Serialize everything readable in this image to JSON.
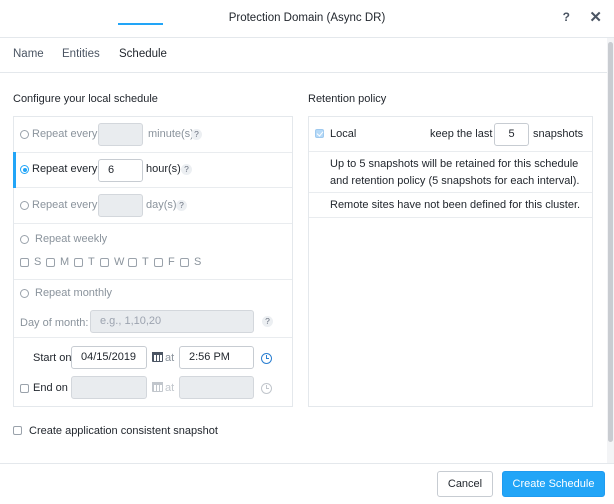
{
  "dialog": {
    "title": "Protection Domain (Async DR)",
    "help_label": "?",
    "close_label": "✕"
  },
  "tabs": [
    {
      "label": "Name",
      "active": false
    },
    {
      "label": "Entities",
      "active": false
    },
    {
      "label": "Schedule",
      "active": true
    }
  ],
  "local_schedule": {
    "title": "Configure your local schedule",
    "repeat_minutes": {
      "label": "Repeat every",
      "value": "",
      "unit": "minute(s)",
      "selected": false
    },
    "repeat_hours": {
      "label": "Repeat every",
      "value": "6",
      "unit": "hour(s)",
      "selected": true
    },
    "repeat_days": {
      "label": "Repeat every",
      "value": "",
      "unit": "day(s)",
      "selected": false
    },
    "repeat_weekly": {
      "label": "Repeat weekly",
      "selected": false,
      "days": [
        "S",
        "M",
        "T",
        "W",
        "T",
        "F",
        "S"
      ]
    },
    "repeat_monthly": {
      "label": "Repeat monthly",
      "selected": false
    },
    "day_of_month": {
      "label": "Day of month:",
      "placeholder": "e.g., 1,10,20"
    },
    "start_on": {
      "label": "Start on",
      "date": "04/15/2019",
      "at_label": "at",
      "time": "2:56 PM"
    },
    "end_on": {
      "label": "End on",
      "checked": false,
      "date": "",
      "at_label": "at",
      "time": ""
    }
  },
  "app_consistent": {
    "label": "Create application consistent snapshot",
    "checked": false
  },
  "retention": {
    "title": "Retention policy",
    "local_label": "Local",
    "local_checked": true,
    "keep_label": "keep the last",
    "keep_value": "5",
    "unit_label": "snapshots",
    "info_line1": "Up to 5 snapshots will be retained for this schedule",
    "info_line2": "and retention policy (5 snapshots for each interval).",
    "remote_note": "Remote sites have not been defined for this cluster."
  },
  "footer": {
    "cancel_label": "Cancel",
    "create_label": "Create Schedule"
  },
  "colors": {
    "accent": "#22a5f7",
    "border": "#e4e8ec",
    "text": "#22272e"
  }
}
